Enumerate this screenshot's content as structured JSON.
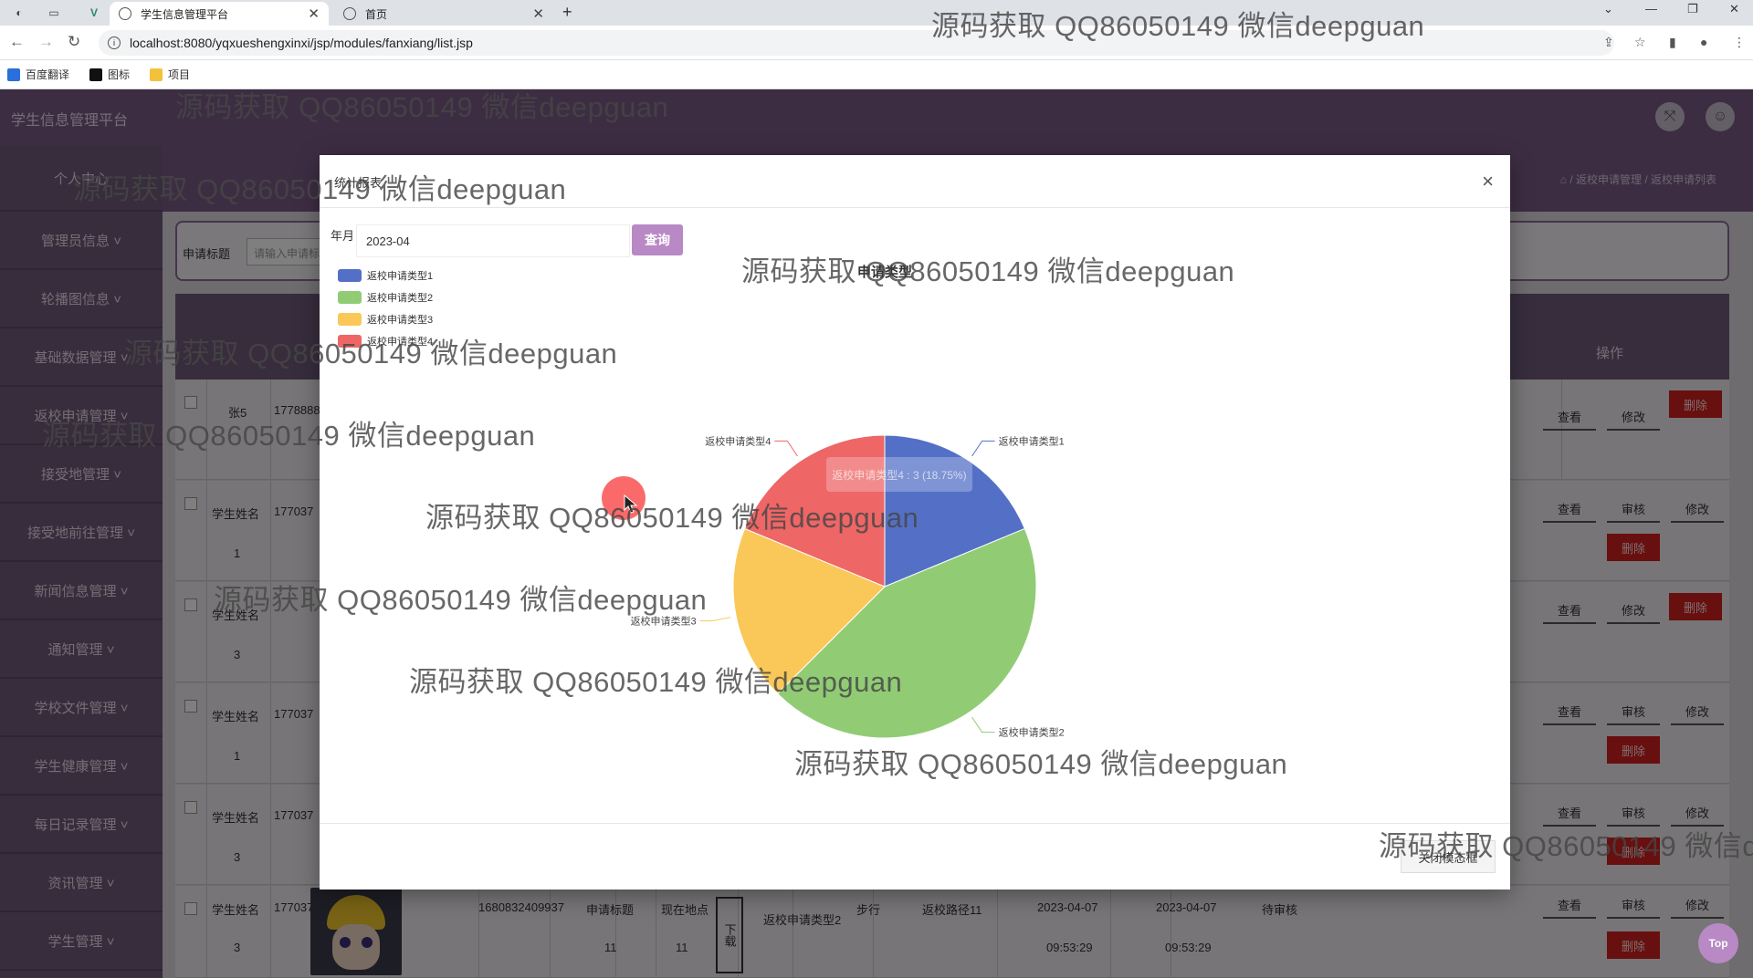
{
  "browser": {
    "tabs": [
      {
        "label": "学生信息管理平台",
        "active": true
      },
      {
        "label": "首页",
        "active": false
      }
    ],
    "url": "localhost:8080/yqxueshengxinxi/jsp/modules/fanxiang/list.jsp",
    "bookmarks": [
      "百度翻译",
      "图标",
      "项目"
    ],
    "new_tab": "+",
    "close_glyph": "✕"
  },
  "app": {
    "title": "学生信息管理平台",
    "breadcrumb": "⌂ / 返校申请管理 / 返校申请列表",
    "sidebar": [
      "个人中心",
      "管理员信息 ˅",
      "轮播图信息 ˅",
      "基础数据管理 ˅",
      "返校申请管理 ˅",
      "接受地管理 ˅",
      "接受地前往管理 ˅",
      "新闻信息管理 ˅",
      "通知管理 ˅",
      "学校文件管理 ˅",
      "学生健康管理 ˅",
      "每日记录管理 ˅",
      "资讯管理 ˅",
      "学生管理 ˅"
    ],
    "search": {
      "label": "申请标题",
      "placeholder": "请输入申请标题"
    },
    "table_header_op": "操作",
    "rows": [
      {
        "name": "张5",
        "num": "",
        "phone": "1778888",
        "buttons": [
          "查看",
          "修改",
          "删除"
        ]
      },
      {
        "name": "学生姓名",
        "num": "1",
        "phone": "177037",
        "buttons": [
          "查看",
          "审核",
          "修改",
          "删除"
        ]
      },
      {
        "name": "学生姓名",
        "num": "3",
        "phone": "",
        "buttons": [
          "查看",
          "修改",
          "删除"
        ]
      },
      {
        "name": "学生姓名",
        "num": "1",
        "phone": "177037",
        "buttons": [
          "查看",
          "审核",
          "修改",
          "删除"
        ]
      },
      {
        "name": "学生姓名",
        "num": "3",
        "phone": "177037",
        "buttons": [
          "查看",
          "审核",
          "修改",
          "删除"
        ]
      },
      {
        "name": "学生姓名",
        "num": "3",
        "phone": "17703786903",
        "id": "1680832409937",
        "title": "申请标题",
        "title_num": "11",
        "loc": "现在地点",
        "loc_num": "11",
        "dl": "下载",
        "type": "返校申请类型2",
        "mode": "步行",
        "route": "返校路径11",
        "date1": "2023-04-07",
        "time1": "09:53:29",
        "date2": "2023-04-07",
        "time2": "09:53:29",
        "status": "待审核",
        "buttons": [
          "查看",
          "审核",
          "修改",
          "删除"
        ]
      }
    ],
    "top_button": "Top",
    "header_icons": [
      "fullscreen-icon",
      "user-icon"
    ]
  },
  "modal": {
    "title": "统计报表",
    "month_label": "年月",
    "month_value": "2023-04",
    "query_button": "查询",
    "close_button": "关闭模态框",
    "tooltip": "返校申请类型4 : 3 (18.75%)"
  },
  "chart_data": {
    "type": "pie",
    "title": "申请类型",
    "series": [
      {
        "name": "返校申请类型1",
        "value": 3,
        "color": "#5470c6"
      },
      {
        "name": "返校申请类型2",
        "value": 7,
        "color": "#91cc75"
      },
      {
        "name": "返校申请类型3",
        "value": 3,
        "color": "#fac858"
      },
      {
        "name": "返校申请类型4",
        "value": 3,
        "color": "#ee6666"
      }
    ],
    "legend_position": "top-left"
  },
  "watermarks": [
    "源码获取 QQ86050149 微信deepguan",
    "源码获取 QQ86050149 微信deepguan",
    "源码获取 QQ86050149 微信deepguan",
    "源码获取 QQ86050149 微信deepguan",
    "源码获取 QQ86050149 微信deepguan",
    "源码获取 QQ86050149 微信deepguan",
    "源码获取 QQ86050149 微信deepguan",
    "源码获取 QQ86050149 微信deepguan",
    "源码获取 QQ86050149 微信deepguan",
    "源码获取 QQ86050149 微信deepguan",
    "源码获取 QQ86050149 微信d"
  ]
}
